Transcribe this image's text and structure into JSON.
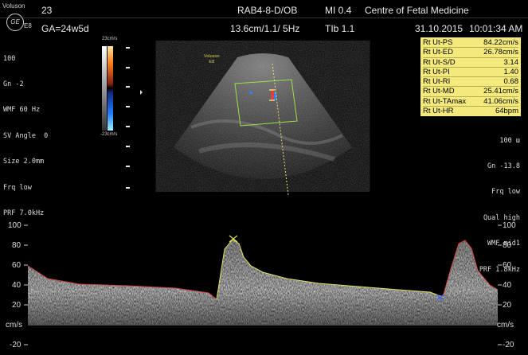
{
  "header": {
    "logo_brand": "Voluson",
    "logo_model": "E8",
    "logo_symbol": "GE",
    "patient_id": "23",
    "ga": "GA=24w5d",
    "probe_mode": "RAB4-8-D/OB",
    "depth_info": "13.6cm/1.1/ 5Hz",
    "mi": "MI 0.4",
    "tib": "TIb 1.1",
    "institution": "Centre of Fetal Medicine",
    "date": "31.10.2015",
    "time": "10:01:34 AM"
  },
  "left_params": [
    "100",
    "Gn -2",
    "WMF 60 Hz",
    "SV Angle  0",
    "Size 2.0mm",
    "Frq low",
    "PRF 7.0kHz"
  ],
  "color_bar": {
    "top_label": "23cm/s",
    "bottom_label": "-23cm/s"
  },
  "image_logo": {
    "brand": "Voluson",
    "model": "E8"
  },
  "measurements": [
    {
      "label": "Rt Ut-PS",
      "value": "84.22cm/s"
    },
    {
      "label": "Rt Ut-ED",
      "value": "26.78cm/s"
    },
    {
      "label": "Rt Ut-S/D",
      "value": "3.14"
    },
    {
      "label": "Rt Ut-PI",
      "value": "1.40"
    },
    {
      "label": "Rt Ut-RI",
      "value": "0.68"
    },
    {
      "label": "Rt Ut-MD",
      "value": "25.41cm/s"
    },
    {
      "label": "Rt Ut-TAmax",
      "value": "41.06cm/s"
    },
    {
      "label": "Rt Ut-HR",
      "value": "64bpm"
    }
  ],
  "right_params": [
    "100 ш",
    "Gn -13.8",
    "Frq low",
    "Qual high",
    "WMF mid1",
    "PRF 1.8kHz"
  ],
  "doppler": {
    "unit": "cm/s",
    "ticks": [
      "100",
      "80",
      "60",
      "40",
      "20",
      "-20"
    ]
  },
  "colors": {
    "measure_bg": "#f3e97d",
    "trace": "#e0e060",
    "flow_red": "#e04040",
    "flow_blue": "#3080ff"
  }
}
